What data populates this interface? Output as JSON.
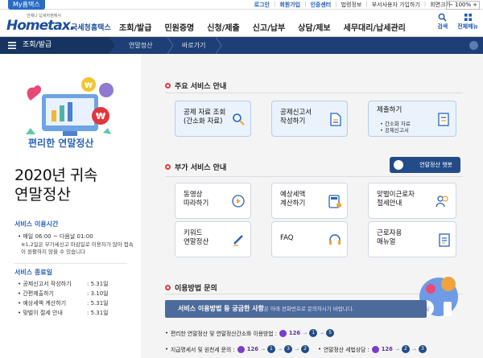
{
  "topbar": {
    "my_tab": "My홈택스",
    "login": "로그인",
    "signup": "회원가입",
    "cert": "인증센터",
    "law": "법령정보",
    "offsite": "부서사용자 가입하기",
    "corp": "회면크기",
    "zoom": "100%"
  },
  "header": {
    "logo_sub": "언제나 납세자편에서",
    "logo_main": "Hometax.",
    "logo_kr": "국세청홈택스",
    "search_label": "검색",
    "menu_label": "전체메뉴"
  },
  "gnb": [
    "조회/발급",
    "민원증명",
    "신청/제출",
    "신고/납부",
    "상담/제보",
    "세무대리/납세관리"
  ],
  "nav": {
    "menu": "조회/발급",
    "crumb1": "연말정산",
    "crumb2": "바로가기"
  },
  "left": {
    "hero_title": "편리한 연말정산",
    "big_line1": "2020년 귀속",
    "big_line2": "연말정산",
    "hours_title": "서비스 이용시간",
    "hours_line": "매일 06:00 ~ 다음날 01:00",
    "hours_note": "※1,2일은 부가세신고 마감일로 이용자가 많아 접속이 원활하지 않을 수 있습니다",
    "end_title": "서비스 종료일",
    "end_rows": [
      {
        "label": "공제신고서 작성하기",
        "date": "5.31일"
      },
      {
        "label": "간편제출하기",
        "date": "3.10일"
      },
      {
        "label": "예상세액 계산하기",
        "date": "5.31일"
      },
      {
        "label": "맞벌이 절세 안내",
        "date": "5.31일"
      }
    ]
  },
  "main": {
    "sec1": "주요 서비스 안내",
    "sec2": "부가 서비스 안내",
    "sec3": "이용방법 문의",
    "chatbot": "연말정산 챗봇",
    "cards1": [
      {
        "l1": "공제 자료 조회",
        "l2": "(간소화 자료)",
        "icon": "search-icon"
      },
      {
        "l1": "공제신고서",
        "l2": "작성하기",
        "icon": "document-icon"
      },
      {
        "l1": "제출하기",
        "s1": "• 간소화 자료",
        "s2": "• 공제신고서",
        "icon": "submit-icon"
      }
    ],
    "cards2": [
      {
        "l1": "동영상",
        "l2": "따라하기",
        "icon": "play-icon"
      },
      {
        "l1": "예상세액",
        "l2": "계산하기",
        "icon": "calculator-icon"
      },
      {
        "l1": "맞벌이근로자",
        "l2": "절세안내",
        "icon": "couple-icon"
      },
      {
        "l1": "키워드",
        "l2": "연말정산",
        "icon": "pencil-icon"
      },
      {
        "l1": "FAQ",
        "l2": "",
        "icon": "headset-icon"
      },
      {
        "l1": "근로자용",
        "l2": "매뉴얼",
        "icon": "manual-icon"
      }
    ],
    "banner_bold": "서비스 이용방법 등 궁금한 사항",
    "banner_rest": "은 아래 전화번호로 문의하시기 바랍니다.",
    "info1_label": "편리한 연말정산 및 연말정산간소화 이용방법 :",
    "info1_num": "126",
    "info1_steps": [
      "1",
      "5"
    ],
    "info2_label": "지급명세서 및 원천세 문의 :",
    "info2_num": "126",
    "info2_steps": [
      "1",
      "3",
      "2"
    ],
    "info3_label": "연말정산 세법상담 :",
    "info3_num": "126",
    "info3_steps": [
      "2",
      "3"
    ]
  },
  "colors": {
    "brand": "#1c4f9c",
    "nav": "#1d3f75",
    "accent": "#2a63ba"
  }
}
